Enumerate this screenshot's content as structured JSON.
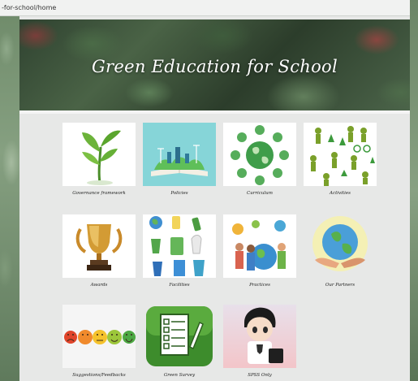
{
  "browser": {
    "url": "-for-school/home"
  },
  "banner": {
    "title": "Green Education for School"
  },
  "tiles": [
    {
      "label": "Governance framework"
    },
    {
      "label": "Policies"
    },
    {
      "label": "Curriculum"
    },
    {
      "label": "Activities"
    },
    {
      "label": "Awards"
    },
    {
      "label": "Facilities"
    },
    {
      "label": "Practices"
    },
    {
      "label": "Our Partners"
    },
    {
      "label": "Suggestions/Feedbacks"
    },
    {
      "label": "Green Survey"
    },
    {
      "label": "SPSS Only"
    }
  ],
  "colors": {
    "banner_text": "#ffffff",
    "page_bg": "#e7e8e7",
    "accent_green": "#3c8a2e"
  }
}
